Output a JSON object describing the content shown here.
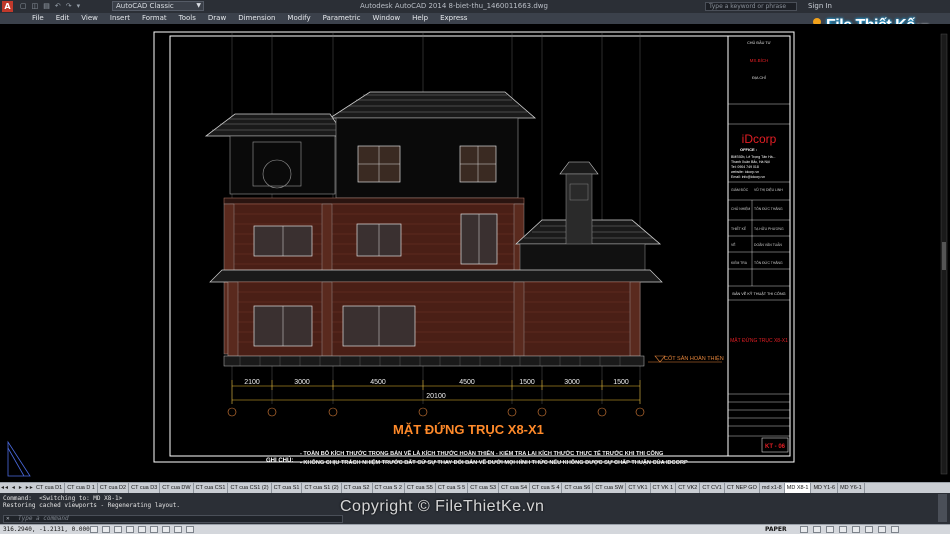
{
  "titlebar": {
    "logo": "A",
    "quick_access": [
      "▢",
      "◫",
      "▤",
      "↶",
      "↷",
      "▾"
    ],
    "workspace": "AutoCAD Classic",
    "title": "Autodesk AutoCAD 2014    8-biet-thu_1460011663.dwg",
    "search_placeholder": "Type a keyword or phrase",
    "sign_in": "Sign In"
  },
  "menubar": {
    "items": [
      "File",
      "Edit",
      "View",
      "Insert",
      "Format",
      "Tools",
      "Draw",
      "Dimension",
      "Modify",
      "Parametric",
      "Window",
      "Help",
      "Express"
    ]
  },
  "brand": {
    "name": "File Thiết Kế",
    "tld": ".vn"
  },
  "drawing": {
    "title": "MẶT ĐỨNG TRỤC X8-X1",
    "overall_dimension": "20100",
    "dimensions": [
      "2100",
      "3000",
      "4500",
      "4500",
      "1500",
      "3000",
      "1500"
    ],
    "level_label": "CỐT SÂN HOÀN THIỆN",
    "note_label": "GHI CHÚ:",
    "notes": [
      "- TOÀN BỘ KÍCH THƯỚC TRONG BẢN VẼ LÀ KÍCH THƯỚC HOÀN THIỆN - KIỂM TRA LẠI KÍCH THƯỚC THỰC TẾ TRƯỚC KHI THI CÔNG",
      "- KHÔNG CHỊU TRÁCH NHIỆM TRƯỚC BẤT CỨ SỰ THAY ĐỔI BẢN VẼ DƯỚI MỌI HÌNH THỨC NẾU KHÔNG ĐƯỢC SỰ CHẤP THUẬN CỦA IDCORP"
    ]
  },
  "titleblock": {
    "owner_label": "CHỦ ĐẦU TƯ",
    "owner_name": "MS.BÍCH",
    "address_label": "ĐỊA CHỈ",
    "company": "iDcorp",
    "office_label": "OFFICE :",
    "office_lines": [
      "BMS92b, Lê Trọng Tấn Hà...",
      "Thanh Xuân Bắc, Hà Nội",
      "Tel: 0904 749 018",
      "website: idcorp.vn",
      "Email: info@idcorp.vn"
    ],
    "roles": [
      "GIÁM ĐỐC",
      "CHỦ NHIỆM",
      "THIẾT KẾ",
      "VẼ",
      "KIỂM TRA"
    ],
    "names": [
      "VŨ THỊ DIỆU LINH",
      "TÔN ĐỨC THẮNG",
      "TẠ HỮU PHƯƠNG",
      "DOÃN VĂN TUẤN",
      "TÔN ĐỨC THẮNG"
    ],
    "sheet_caption": "BẢN VẼ KỸ THUẬT THI CÔNG",
    "sheet_title": "MẶT ĐỨNG TRỤC X8-X1",
    "sheet_number": "KT - 06"
  },
  "tabs": {
    "nav": "◂◂ ◂ ▸ ▸▸",
    "items": [
      "CT cua D1",
      "CT cua D 1",
      "CT cua D2",
      "CT cua D3",
      "CT cua DW",
      "CT cua CS1",
      "CT cua CS1 (2)",
      "CT cua S1",
      "CT cua S1 (2)",
      "CT cua S2",
      "CT cua S 2",
      "CT cua S5",
      "CT cua S 5",
      "CT cua S3",
      "CT cua S4",
      "CT cua S 4",
      "CT cua S6",
      "CT cua SW",
      "CT VK1",
      "CT VK 1",
      "CT VK2",
      "CT CV1",
      "CT NEP GO",
      "md x1-8",
      "MD X8-1",
      "MD Y1-6",
      "MD Y6-1"
    ],
    "active_index": 24
  },
  "command": {
    "history": [
      "Command:  <Switching to: MD X8-1>",
      "Restoring cached viewports - Regenerating layout."
    ],
    "placeholder": "Type a command"
  },
  "status": {
    "coords": "316.2940, -1.2131, 0.0000",
    "space": "PAPER"
  },
  "watermark": "Copyright © FileThietKe.vn",
  "colors": {
    "background": "#000000",
    "frame": "#ffffff",
    "dimension": "#f2c230",
    "title_text": "#ff8a2a",
    "company": "#e31e24",
    "brick": "#6b2a1e",
    "roof": "#cfcfcf"
  }
}
